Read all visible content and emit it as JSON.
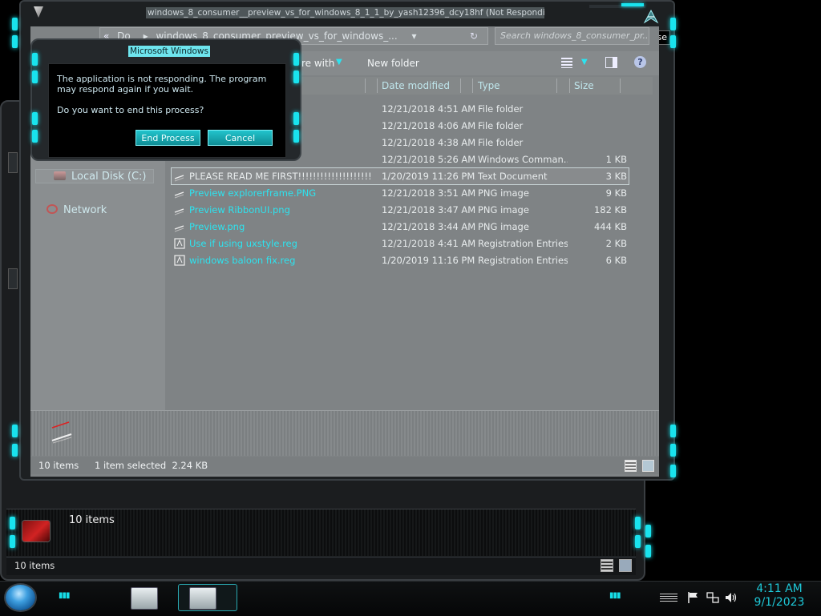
{
  "window": {
    "title": "windows_8_consumer__preview_vs_for_windows_8_1_1_by_yash12396_dcy18hf (Not Responding)",
    "close_tooltip": "Close"
  },
  "address": {
    "path_start": "Do",
    "path_current": "windows_8_consumer_preview_vs_for_windows_...",
    "search_placeholder": "Search windows_8_consumer_pr..."
  },
  "toolbar": {
    "share_label": "re with",
    "new_folder_label": "New folder"
  },
  "columns": {
    "date": "Date modified",
    "type": "Type",
    "size": "Size"
  },
  "nav": {
    "local_disk": "Local Disk (C:)",
    "network": "Network"
  },
  "files": [
    {
      "name": "",
      "date": "12/21/2018 4:51 AM",
      "type": "File folder",
      "size": ""
    },
    {
      "name": "",
      "date": "12/21/2018 4:06 AM",
      "type": "File folder",
      "size": ""
    },
    {
      "name": "",
      "date": "12/21/2018 4:38 AM",
      "type": "File folder",
      "size": ""
    },
    {
      "name": "",
      "date": "12/21/2018 5:26 AM",
      "type": "Windows Comman...",
      "size": "1 KB"
    },
    {
      "name": "PLEASE READ ME FIRST!!!!!!!!!!!!!!!!!!!!!!!!!!!!!!!!!!",
      "date": "1/20/2019 11:26 PM",
      "type": "Text Document",
      "size": "3 KB"
    },
    {
      "name": "Preview explorerframe.PNG",
      "date": "12/21/2018 3:51 AM",
      "type": "PNG image",
      "size": "9 KB"
    },
    {
      "name": "Preview RibbonUI.png",
      "date": "12/21/2018 3:47 AM",
      "type": "PNG image",
      "size": "182 KB"
    },
    {
      "name": "Preview.png",
      "date": "12/21/2018 3:44 AM",
      "type": "PNG image",
      "size": "444 KB"
    },
    {
      "name": "Use if using uxstyle.reg",
      "date": "12/21/2018 4:41 AM",
      "type": "Registration Entries",
      "size": "2 KB"
    },
    {
      "name": "windows baloon fix.reg",
      "date": "1/20/2019 11:16 PM",
      "type": "Registration Entries",
      "size": "6 KB"
    }
  ],
  "status": {
    "item_count": "10 items",
    "selection": "1 item selected  2.24 KB"
  },
  "dialog": {
    "title": "Microsoft Windows",
    "message": "The application is not responding. The program may respond again if you wait.",
    "question": "Do you want to end this process?",
    "end_button": "End Process",
    "cancel_button": "Cancel"
  },
  "background_window": {
    "details_text": "10 items",
    "status_text": "10 items"
  },
  "taskbar": {
    "time": "4:11 AM",
    "date": "9/1/2023"
  },
  "colors": {
    "accent": "#19e3ee",
    "clock": "#1ec8d8",
    "link_text": "#2de3ef"
  }
}
